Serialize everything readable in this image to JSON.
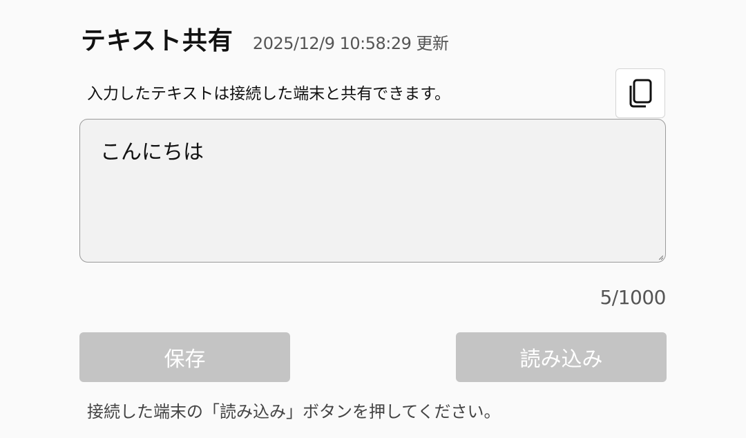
{
  "header": {
    "title": "テキスト共有",
    "updated": "2025/12/9 10:58:29 更新"
  },
  "description": "入力したテキストは接続した端末と共有できます。",
  "copy_button": {
    "icon": "copy-icon"
  },
  "textarea": {
    "value": "こんにちは"
  },
  "char_count": "5/1000",
  "buttons": {
    "save_label": "保存",
    "load_label": "読み込み"
  },
  "instruction": "接続した端末の「読み込み」ボタンを押してください。",
  "colors": {
    "background": "#fafafa",
    "button_disabled": "#c4c4c4",
    "textarea_bg": "#f2f2f2"
  }
}
